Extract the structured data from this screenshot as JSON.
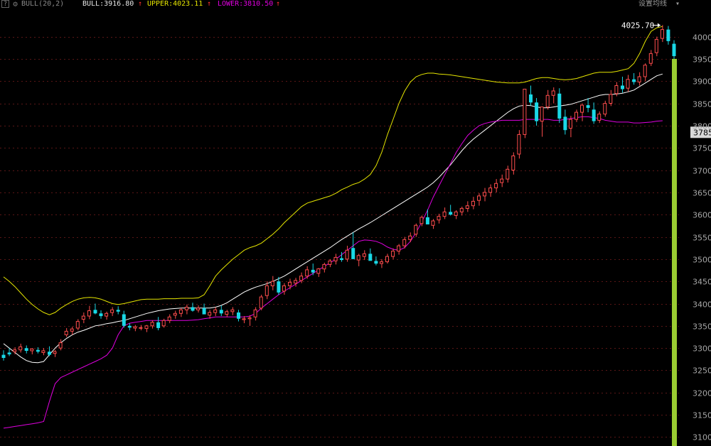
{
  "indicator": {
    "help": "?",
    "name": "BULL(20,2)",
    "bull": "BULL:3916.80",
    "upper": "UPPER:4023.11",
    "lower": "LOWER:3810.50",
    "arrow": "↑",
    "settings": "设置均线",
    "settings_caret": "▾"
  },
  "colors": {
    "background": "#000000",
    "grid": "#5a1616",
    "up_candle": "#ff4d4d",
    "down_candle": "#19d8e6",
    "bull_line": "#ffffff",
    "upper_line": "#e6e600",
    "lower_line": "#e000e0",
    "crosshair": "#9acd32"
  },
  "chart_data": {
    "type": "candlestick",
    "y_ticks": [
      4000,
      3950,
      3900,
      3850,
      3800,
      3750,
      3700,
      3650,
      3600,
      3550,
      3500,
      3450,
      3400,
      3350,
      3300,
      3250,
      3200,
      3150,
      3100
    ],
    "ylim": [
      3080,
      4060
    ],
    "grid": true,
    "max_annotation": "4025.70",
    "crosshair_value": "3785",
    "bull": [
      3310,
      3300,
      3290,
      3280,
      3272,
      3268,
      3267,
      3270,
      3285,
      3300,
      3312,
      3322,
      3330,
      3336,
      3340,
      3345,
      3350,
      3352,
      3355,
      3357,
      3360,
      3362,
      3366,
      3370,
      3374,
      3378,
      3381,
      3384,
      3386,
      3388,
      3389,
      3390,
      3390,
      3390,
      3390,
      3390,
      3390,
      3392,
      3396,
      3402,
      3410,
      3418,
      3426,
      3432,
      3437,
      3441,
      3445,
      3450,
      3456,
      3462,
      3470,
      3478,
      3486,
      3494,
      3502,
      3510,
      3518,
      3526,
      3535,
      3544,
      3552,
      3560,
      3568,
      3575,
      3582,
      3590,
      3598,
      3606,
      3614,
      3622,
      3630,
      3638,
      3646,
      3654,
      3662,
      3672,
      3684,
      3698,
      3712,
      3728,
      3744,
      3758,
      3770,
      3780,
      3790,
      3800,
      3810,
      3820,
      3830,
      3838,
      3844,
      3846,
      3845,
      3842,
      3840,
      3840,
      3842,
      3844,
      3846,
      3848,
      3852,
      3856,
      3860,
      3864,
      3868,
      3870,
      3870,
      3871,
      3873,
      3876,
      3880,
      3888,
      3896,
      3904,
      3912,
      3916
    ],
    "upper": [
      3460,
      3450,
      3438,
      3424,
      3410,
      3398,
      3388,
      3380,
      3375,
      3380,
      3390,
      3398,
      3405,
      3410,
      3413,
      3414,
      3413,
      3410,
      3405,
      3400,
      3398,
      3400,
      3403,
      3406,
      3409,
      3410,
      3410,
      3410,
      3411,
      3411,
      3411,
      3412,
      3412,
      3412,
      3413,
      3420,
      3440,
      3462,
      3476,
      3488,
      3500,
      3510,
      3520,
      3526,
      3530,
      3536,
      3546,
      3556,
      3568,
      3582,
      3594,
      3606,
      3618,
      3626,
      3630,
      3634,
      3638,
      3642,
      3648,
      3656,
      3662,
      3668,
      3672,
      3680,
      3690,
      3710,
      3740,
      3780,
      3815,
      3850,
      3878,
      3898,
      3910,
      3915,
      3918,
      3918,
      3916,
      3915,
      3914,
      3912,
      3910,
      3908,
      3906,
      3904,
      3902,
      3900,
      3898,
      3897,
      3896,
      3896,
      3896,
      3898,
      3902,
      3906,
      3908,
      3908,
      3906,
      3904,
      3903,
      3904,
      3906,
      3910,
      3914,
      3918,
      3920,
      3920,
      3920,
      3922,
      3925,
      3928,
      3940,
      3962,
      3990,
      4012,
      4020,
      4023
    ],
    "lower": [
      3120,
      3122,
      3124,
      3126,
      3128,
      3130,
      3132,
      3135,
      3180,
      3220,
      3234,
      3240,
      3246,
      3252,
      3258,
      3264,
      3270,
      3276,
      3284,
      3300,
      3330,
      3350,
      3356,
      3358,
      3360,
      3362,
      3362,
      3362,
      3362,
      3362,
      3362,
      3362,
      3362,
      3363,
      3364,
      3366,
      3368,
      3370,
      3370,
      3370,
      3370,
      3370,
      3370,
      3372,
      3378,
      3390,
      3400,
      3410,
      3420,
      3428,
      3436,
      3444,
      3452,
      3460,
      3468,
      3476,
      3484,
      3492,
      3500,
      3510,
      3520,
      3530,
      3540,
      3543,
      3542,
      3540,
      3535,
      3527,
      3522,
      3520,
      3526,
      3540,
      3560,
      3584,
      3610,
      3640,
      3665,
      3690,
      3715,
      3740,
      3760,
      3778,
      3790,
      3800,
      3805,
      3808,
      3810,
      3812,
      3812,
      3812,
      3812,
      3814,
      3814,
      3814,
      3814,
      3814,
      3812,
      3812,
      3814,
      3816,
      3818,
      3820,
      3820,
      3818,
      3816,
      3812,
      3810,
      3808,
      3808,
      3808,
      3806,
      3806,
      3807,
      3808,
      3810,
      3811
    ],
    "ohlc": [
      [
        3285,
        3295,
        3272,
        3278
      ],
      [
        3290,
        3300,
        3282,
        3286
      ],
      [
        3292,
        3302,
        3286,
        3296
      ],
      [
        3296,
        3310,
        3290,
        3303
      ],
      [
        3300,
        3306,
        3288,
        3294
      ],
      [
        3294,
        3300,
        3286,
        3298
      ],
      [
        3296,
        3302,
        3288,
        3292
      ],
      [
        3290,
        3300,
        3284,
        3294
      ],
      [
        3292,
        3304,
        3282,
        3285
      ],
      [
        3288,
        3296,
        3280,
        3292
      ],
      [
        3300,
        3320,
        3295,
        3312
      ],
      [
        3330,
        3345,
        3325,
        3338
      ],
      [
        3338,
        3348,
        3330,
        3343
      ],
      [
        3345,
        3365,
        3340,
        3360
      ],
      [
        3365,
        3380,
        3356,
        3372
      ],
      [
        3372,
        3395,
        3365,
        3384
      ],
      [
        3386,
        3400,
        3376,
        3378
      ],
      [
        3378,
        3385,
        3366,
        3372
      ],
      [
        3372,
        3382,
        3364,
        3378
      ],
      [
        3380,
        3392,
        3372,
        3386
      ],
      [
        3386,
        3394,
        3376,
        3382
      ],
      [
        3376,
        3384,
        3346,
        3350
      ],
      [
        3350,
        3356,
        3340,
        3346
      ],
      [
        3345,
        3352,
        3338,
        3348
      ],
      [
        3346,
        3352,
        3340,
        3346
      ],
      [
        3344,
        3352,
        3336,
        3350
      ],
      [
        3350,
        3362,
        3344,
        3358
      ],
      [
        3358,
        3370,
        3340,
        3345
      ],
      [
        3350,
        3366,
        3346,
        3362
      ],
      [
        3362,
        3376,
        3356,
        3370
      ],
      [
        3374,
        3384,
        3366,
        3378
      ],
      [
        3378,
        3390,
        3370,
        3386
      ],
      [
        3386,
        3398,
        3376,
        3392
      ],
      [
        3392,
        3402,
        3382,
        3384
      ],
      [
        3386,
        3396,
        3380,
        3390
      ],
      [
        3390,
        3400,
        3380,
        3376
      ],
      [
        3374,
        3386,
        3366,
        3380
      ],
      [
        3380,
        3392,
        3372,
        3386
      ],
      [
        3386,
        3396,
        3372,
        3378
      ],
      [
        3376,
        3386,
        3370,
        3382
      ],
      [
        3382,
        3392,
        3374,
        3386
      ],
      [
        3380,
        3386,
        3360,
        3366
      ],
      [
        3364,
        3372,
        3356,
        3366
      ],
      [
        3366,
        3374,
        3350,
        3368
      ],
      [
        3370,
        3392,
        3362,
        3386
      ],
      [
        3390,
        3420,
        3385,
        3415
      ],
      [
        3418,
        3450,
        3410,
        3440
      ],
      [
        3440,
        3462,
        3430,
        3450
      ],
      [
        3450,
        3460,
        3420,
        3425
      ],
      [
        3428,
        3446,
        3420,
        3440
      ],
      [
        3440,
        3456,
        3432,
        3448
      ],
      [
        3446,
        3458,
        3438,
        3452
      ],
      [
        3452,
        3470,
        3446,
        3462
      ],
      [
        3462,
        3484,
        3456,
        3476
      ],
      [
        3476,
        3490,
        3464,
        3470
      ],
      [
        3468,
        3480,
        3460,
        3478
      ],
      [
        3478,
        3492,
        3470,
        3488
      ],
      [
        3488,
        3500,
        3482,
        3496
      ],
      [
        3496,
        3512,
        3488,
        3504
      ],
      [
        3502,
        3516,
        3494,
        3498
      ],
      [
        3500,
        3530,
        3494,
        3520
      ],
      [
        3525,
        3560,
        3518,
        3500
      ],
      [
        3498,
        3512,
        3484,
        3508
      ],
      [
        3506,
        3520,
        3498,
        3512
      ],
      [
        3512,
        3524,
        3504,
        3496
      ],
      [
        3496,
        3506,
        3486,
        3490
      ],
      [
        3490,
        3500,
        3480,
        3494
      ],
      [
        3494,
        3512,
        3490,
        3506
      ],
      [
        3506,
        3524,
        3500,
        3518
      ],
      [
        3518,
        3534,
        3510,
        3530
      ],
      [
        3530,
        3550,
        3524,
        3544
      ],
      [
        3544,
        3560,
        3538,
        3552
      ],
      [
        3556,
        3580,
        3550,
        3576
      ],
      [
        3580,
        3598,
        3574,
        3594
      ],
      [
        3594,
        3612,
        3586,
        3578
      ],
      [
        3576,
        3590,
        3568,
        3586
      ],
      [
        3588,
        3602,
        3580,
        3596
      ],
      [
        3596,
        3616,
        3590,
        3606
      ],
      [
        3606,
        3622,
        3598,
        3600
      ],
      [
        3598,
        3610,
        3590,
        3606
      ],
      [
        3606,
        3618,
        3598,
        3614
      ],
      [
        3614,
        3630,
        3606,
        3620
      ],
      [
        3620,
        3640,
        3612,
        3630
      ],
      [
        3632,
        3648,
        3620,
        3642
      ],
      [
        3642,
        3660,
        3630,
        3650
      ],
      [
        3650,
        3668,
        3640,
        3660
      ],
      [
        3660,
        3680,
        3650,
        3670
      ],
      [
        3672,
        3690,
        3662,
        3680
      ],
      [
        3680,
        3710,
        3672,
        3702
      ],
      [
        3700,
        3740,
        3690,
        3732
      ],
      [
        3736,
        3790,
        3726,
        3780
      ],
      [
        3780,
        3860,
        3772,
        3882
      ],
      [
        3870,
        3890,
        3845,
        3852
      ],
      [
        3852,
        3862,
        3800,
        3810
      ],
      [
        3810,
        3826,
        3775,
        3842
      ],
      [
        3842,
        3880,
        3836,
        3868
      ],
      [
        3868,
        3886,
        3850,
        3878
      ],
      [
        3872,
        3884,
        3806,
        3816
      ],
      [
        3820,
        3836,
        3780,
        3790
      ],
      [
        3794,
        3822,
        3774,
        3814
      ],
      [
        3814,
        3836,
        3808,
        3830
      ],
      [
        3830,
        3850,
        3810,
        3846
      ],
      [
        3846,
        3862,
        3830,
        3840
      ],
      [
        3836,
        3852,
        3804,
        3810
      ],
      [
        3812,
        3832,
        3806,
        3826
      ],
      [
        3826,
        3856,
        3820,
        3850
      ],
      [
        3850,
        3880,
        3844,
        3870
      ],
      [
        3872,
        3898,
        3866,
        3890
      ],
      [
        3890,
        3910,
        3874,
        3882
      ],
      [
        3884,
        3914,
        3876,
        3904
      ],
      [
        3904,
        3918,
        3892,
        3898
      ],
      [
        3898,
        3920,
        3890,
        3910
      ],
      [
        3910,
        3940,
        3900,
        3936
      ],
      [
        3940,
        3970,
        3934,
        3962
      ],
      [
        3964,
        4000,
        3956,
        3994
      ],
      [
        3996,
        4026,
        3988,
        4016
      ],
      [
        4016,
        4024,
        3982,
        3990
      ],
      [
        3984,
        3992,
        3950,
        3956
      ]
    ]
  }
}
